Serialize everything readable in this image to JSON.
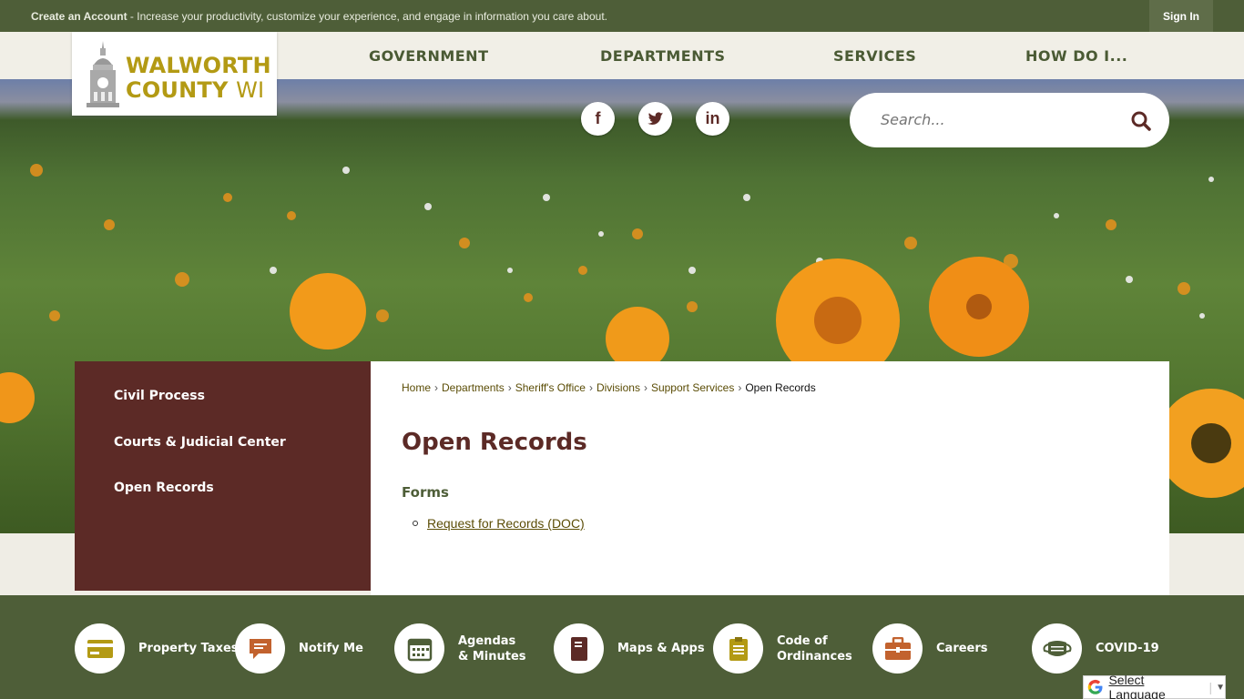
{
  "topbar": {
    "create_account": "Create an Account",
    "message": " - Increase your productivity, customize your experience, and engage in information you care about.",
    "sign_in": "Sign In"
  },
  "logo": {
    "line1": "WALWORTH",
    "line2a": "COUNTY ",
    "line2b": "WI"
  },
  "nav": {
    "government": "GOVERNMENT",
    "departments": "DEPARTMENTS",
    "services": "SERVICES",
    "how_do_i": "HOW DO I..."
  },
  "social": {
    "facebook": "f",
    "twitter": "t",
    "linkedin": "in"
  },
  "search": {
    "placeholder": "Search..."
  },
  "sidebar": {
    "items": [
      "Civil Process",
      "Courts & Judicial Center",
      "Open Records"
    ]
  },
  "breadcrumb": {
    "items": [
      "Home",
      "Departments",
      "Sheriff's Office",
      "Divisions",
      "Support Services"
    ],
    "current": "Open Records",
    "separator": "›"
  },
  "page": {
    "title": "Open Records",
    "section": "Forms",
    "links": [
      "Request for Records (DOC)"
    ]
  },
  "quicklinks": [
    {
      "label": "Property Taxes",
      "icon": "credit-card-icon"
    },
    {
      "label": "Notify Me",
      "icon": "chat-bubble-icon"
    },
    {
      "label": "Agendas\n& Minutes",
      "icon": "calendar-icon"
    },
    {
      "label": "Maps & Apps",
      "icon": "book-icon"
    },
    {
      "label": "Code of\nOrdinances",
      "icon": "clipboard-icon"
    },
    {
      "label": "Careers",
      "icon": "briefcase-icon"
    },
    {
      "label": "COVID-19",
      "icon": "face-mask-icon"
    }
  ],
  "translate": {
    "label": "Select Language"
  },
  "colors": {
    "green": "#4e5e38",
    "maroon": "#5c2a26",
    "gold": "#b39a14"
  }
}
